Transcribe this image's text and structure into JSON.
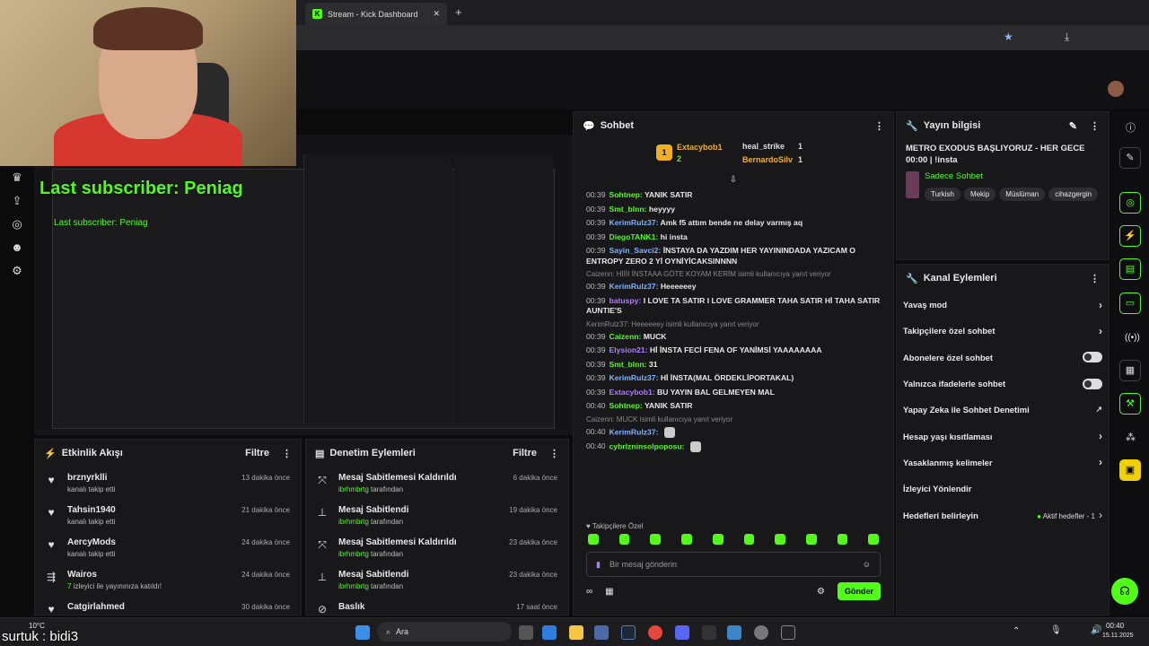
{
  "browser": {
    "tab_title": "Stream - Kick Dashboard",
    "tab_close": "✕",
    "new_tab": "+"
  },
  "overlay": {
    "last_subscriber": "Last subscriber: Peniag",
    "last_subscriber_small": "Last subscriber: Peniag",
    "bottom_tag": "surtuk : bidi3"
  },
  "activity": {
    "title": "Etkinlik Akışı",
    "filter": "Filtre",
    "rows": [
      {
        "icon": "heart-icon",
        "name": "brznyrklli",
        "sub": "kanalı takip etti",
        "time": "13 dakika önce"
      },
      {
        "icon": "heart-icon",
        "name": "Tahsin1940",
        "sub": "kanalı takip etti",
        "time": "21 dakika önce"
      },
      {
        "icon": "heart-icon",
        "name": "AercyMods",
        "sub": "kanalı takip etti",
        "time": "24 dakika önce"
      },
      {
        "icon": "raid-icon",
        "name": "Wairos",
        "sub_count": "7",
        "sub": "izleyici ile yayınınıza katıldı!",
        "time": "24 dakika önce"
      },
      {
        "icon": "heart-icon",
        "name": "Catgirlahmed",
        "sub": "",
        "time": "30 dakika önce"
      }
    ]
  },
  "moderation": {
    "title": "Denetim Eylemleri",
    "filter": "Filtre",
    "rows": [
      {
        "icon": "unpin-icon",
        "action": "Mesaj Sabitlemesi Kaldırıldı",
        "user": "ibrhmbrtg",
        "suffix": "tarafından",
        "time": "6 dakika önce"
      },
      {
        "icon": "pin-icon",
        "action": "Mesaj Sabitlendi",
        "user": "ibrhmbrtg",
        "suffix": "tarafından",
        "time": "19 dakika önce"
      },
      {
        "icon": "unpin-icon",
        "action": "Mesaj Sabitlemesi Kaldırıldı",
        "user": "ibrhmbrtg",
        "suffix": "tarafından",
        "time": "23 dakika önce"
      },
      {
        "icon": "pin-icon",
        "action": "Mesaj Sabitlendi",
        "user": "ibrhmbrtg",
        "suffix": "tarafından",
        "time": "23 dakika önce"
      },
      {
        "icon": "ban-icon",
        "action": "Baslık",
        "user": "",
        "suffix": "",
        "time": "17 saat önce"
      }
    ]
  },
  "chat": {
    "title": "Sohbet",
    "leaderboard": {
      "first_name": "Extacybob1",
      "first_count": "2",
      "second_name": "heal_strike",
      "second_count": "1",
      "third_name": "BernardoSilv",
      "third_count": "1",
      "rank": "1"
    },
    "messages": [
      {
        "time": "00:39",
        "user": "Sohtnep:",
        "color": "#53fc18",
        "text": "YANIK SATIR"
      },
      {
        "time": "00:39",
        "user": "Smt_blnn:",
        "color": "#53fc18",
        "text": "heyyyy"
      },
      {
        "time": "00:39",
        "user": "KerimRulz37:",
        "color": "#7fb4ff",
        "text": "Amk f5 attım bende ne delay varmış aq"
      },
      {
        "time": "00:39",
        "user": "DiegoTANK1:",
        "color": "#53fc18",
        "text": "hi insta"
      },
      {
        "time": "00:39",
        "user": "Sayin_Savci2:",
        "color": "#7fb4ff",
        "text": "İNSTAYA DA YAZDIM HER YAYININDADA YAZICAM O ENTROPY ZERO 2 Yİ OYNİYİCAKSINNNN"
      },
      {
        "reply": "Caizenn: HİİİI İNSTAAA GÖTE KOYAM KERİM isimli kullanıcıya yanıt veriyor"
      },
      {
        "time": "00:39",
        "user": "KerimRulz37:",
        "color": "#7fb4ff",
        "text": "Heeeeeey"
      },
      {
        "time": "00:39",
        "user": "batuspy:",
        "color": "#b07dff",
        "text": "I LOVE TA SATIR I LOVE GRAMMER TAHA SATIR Hİ TAHA SATIR AUNTIE'S"
      },
      {
        "reply": "KerimRulz37: Heeeeeey isimli kullanıcıya yanıt veriyor"
      },
      {
        "time": "00:39",
        "user": "Caizenn:",
        "color": "#53fc18",
        "text": "MUCK"
      },
      {
        "time": "00:39",
        "user": "Elysion21:",
        "color": "#b07dff",
        "text": "Hİ İNSTA FECİ FENA OF YANİMSİ YAAAAAAAA"
      },
      {
        "time": "00:39",
        "user": "Smt_blnn:",
        "color": "#53fc18",
        "text": "31"
      },
      {
        "time": "00:39",
        "user": "KerimRulz37:",
        "color": "#7fb4ff",
        "text": "Hİ İNSTA(MAL ÖRDEKLİPORTAKAL)"
      },
      {
        "time": "00:39",
        "user": "Extacybob1:",
        "color": "#b07dff",
        "text": "BU YAYIN BAL GELMEYEN MAL"
      },
      {
        "time": "00:40",
        "user": "Sohtnep:",
        "color": "#53fc18",
        "text": "YANIK SATIR"
      },
      {
        "reply": "Caizenn: MUCK isimli kullanıcıya yanıt veriyor"
      },
      {
        "time": "00:40",
        "user": "KerimRulz37:",
        "color": "#7fb4ff",
        "text": ""
      },
      {
        "time": "00:40",
        "user": "cybrlzninsolpoposu:",
        "color": "#53fc18",
        "text": ""
      }
    ],
    "followers_only": "Takipçilere Özel",
    "input_placeholder": "Bir mesaj gönderin",
    "send": "Gönder"
  },
  "stream_info": {
    "title": "Yayın bilgisi",
    "stream_title": "METRO EXODUS BAŞLIYORUZ - HER GECE 00:00 | !insta",
    "category": "Sadece Sohbet",
    "tags": [
      "Turkish",
      "Mekip",
      "Müslüman",
      "cihazgergin"
    ]
  },
  "channel_actions": {
    "title": "Kanal Eylemleri",
    "items": [
      {
        "label": "Yavaş mod",
        "type": "chevron"
      },
      {
        "label": "Takipçilere özel sohbet",
        "type": "chevron"
      },
      {
        "label": "Abonelere özel sohbet",
        "type": "toggle"
      },
      {
        "label": "Yalnızca ifadelerle sohbet",
        "type": "toggle"
      },
      {
        "label": "Yapay Zeka ile Sohbet Denetimi",
        "type": "external"
      },
      {
        "label": "Hesap yaşı kısıtlaması",
        "type": "chevron"
      },
      {
        "label": "Yasaklanmış kelimeler",
        "type": "chevron"
      },
      {
        "label": "İzleyici Yönlendir",
        "type": "none"
      },
      {
        "label": "Hedefleri belirleyin",
        "type": "goal",
        "extra": "Aktif hedefler - 1"
      }
    ]
  },
  "taskbar": {
    "search": "Ara",
    "weather": "10°C",
    "time": "00:40",
    "date": "15.11.2025"
  }
}
